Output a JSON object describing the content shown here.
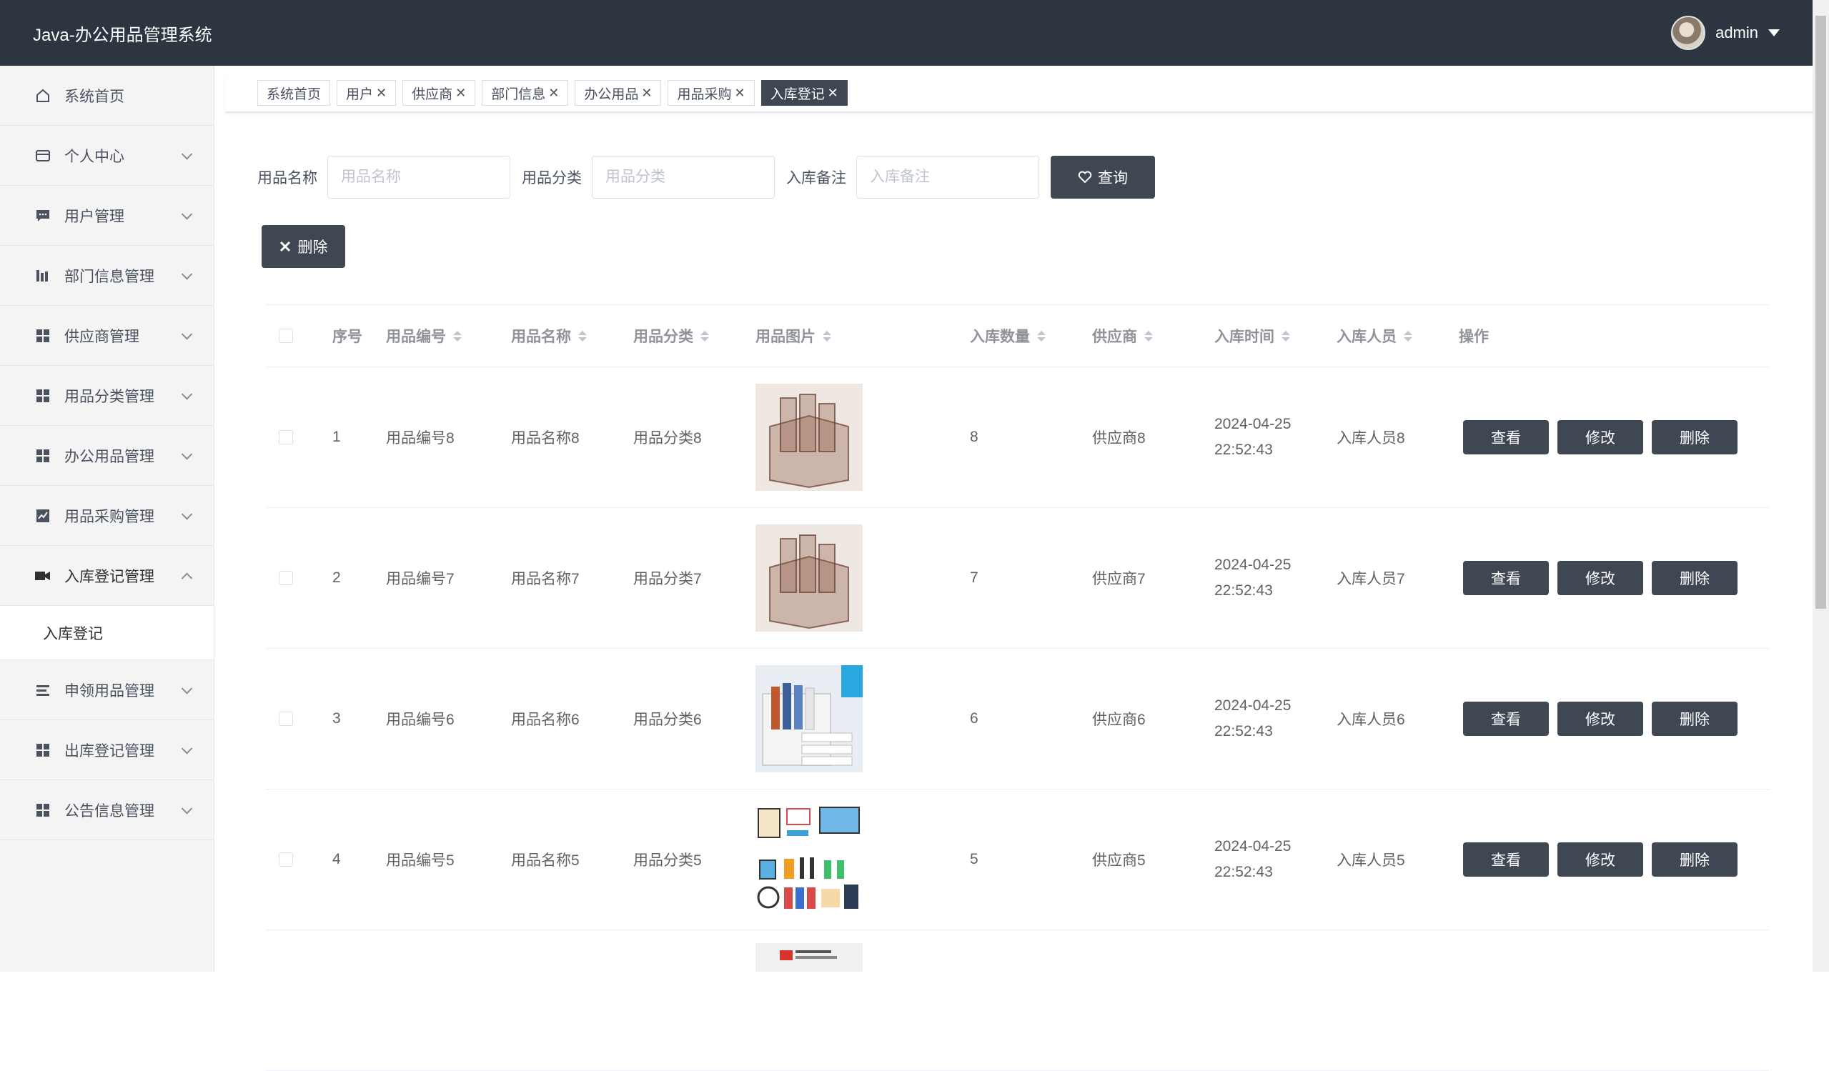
{
  "header": {
    "app_title": "Java-办公用品管理系统",
    "username": "admin"
  },
  "sidebar": {
    "items": [
      {
        "label": "系统首页",
        "icon": "home-icon"
      },
      {
        "label": "个人中心",
        "icon": "card-icon"
      },
      {
        "label": "用户管理",
        "icon": "chat-icon"
      },
      {
        "label": "部门信息管理",
        "icon": "chart-bars-icon"
      },
      {
        "label": "供应商管理",
        "icon": "grid-icon"
      },
      {
        "label": "用品分类管理",
        "icon": "grid-icon"
      },
      {
        "label": "办公用品管理",
        "icon": "grid-icon"
      },
      {
        "label": "用品采购管理",
        "icon": "trend-icon"
      },
      {
        "label": "入库登记管理",
        "icon": "camera-icon"
      },
      {
        "label": "申领用品管理",
        "icon": "list-icon"
      },
      {
        "label": "出库登记管理",
        "icon": "grid-icon"
      },
      {
        "label": "公告信息管理",
        "icon": "grid-icon"
      }
    ],
    "sub_item": "入库登记"
  },
  "tabs": [
    {
      "label": "系统首页"
    },
    {
      "label": "用户",
      "close": "✕"
    },
    {
      "label": "供应商",
      "close": "✕"
    },
    {
      "label": "部门信息",
      "close": "✕"
    },
    {
      "label": "办公用品",
      "close": "✕"
    },
    {
      "label": "用品采购",
      "close": "✕"
    },
    {
      "label": "入库登记",
      "close": "✕"
    }
  ],
  "search": {
    "name_label": "用品名称",
    "name_placeholder": "用品名称",
    "category_label": "用品分类",
    "category_placeholder": "用品分类",
    "remark_label": "入库备注",
    "remark_placeholder": "入库备注",
    "query_label": "查询",
    "delete_label": "删除"
  },
  "table": {
    "headers": {
      "index": "序号",
      "code": "用品编号",
      "name": "用品名称",
      "category": "用品分类",
      "image": "用品图片",
      "qty": "入库数量",
      "supplier": "供应商",
      "time": "入库时间",
      "person": "入库人员",
      "ops": "操作"
    },
    "ops": {
      "view": "查看",
      "edit": "修改",
      "delete": "删除"
    },
    "rows": [
      {
        "index": "1",
        "code": "用品编号8",
        "name": "用品名称8",
        "category": "用品分类8",
        "image": "desk-organizer-photo",
        "qty": "8",
        "supplier": "供应商8",
        "time": "2024-04-25 22:52:43",
        "person": "入库人员8"
      },
      {
        "index": "2",
        "code": "用品编号7",
        "name": "用品名称7",
        "category": "用品分类7",
        "image": "desk-organizer-photo",
        "qty": "7",
        "supplier": "供应商7",
        "time": "2024-04-25 22:52:43",
        "person": "入库人员7"
      },
      {
        "index": "3",
        "code": "用品编号6",
        "name": "用品名称6",
        "category": "用品分类6",
        "image": "file-shelf-photo",
        "qty": "6",
        "supplier": "供应商6",
        "time": "2024-04-25 22:52:43",
        "person": "入库人员6"
      },
      {
        "index": "4",
        "code": "用品编号5",
        "name": "用品名称5",
        "category": "用品分类5",
        "image": "office-supplies-icons-photo",
        "qty": "5",
        "supplier": "供应商5",
        "time": "2024-04-25 22:52:43",
        "person": "入库人员5"
      }
    ]
  },
  "colors": {
    "header_bg": "#2d3540",
    "button_dark": "#3f4753",
    "sidebar_bg": "#f4f4f5"
  }
}
